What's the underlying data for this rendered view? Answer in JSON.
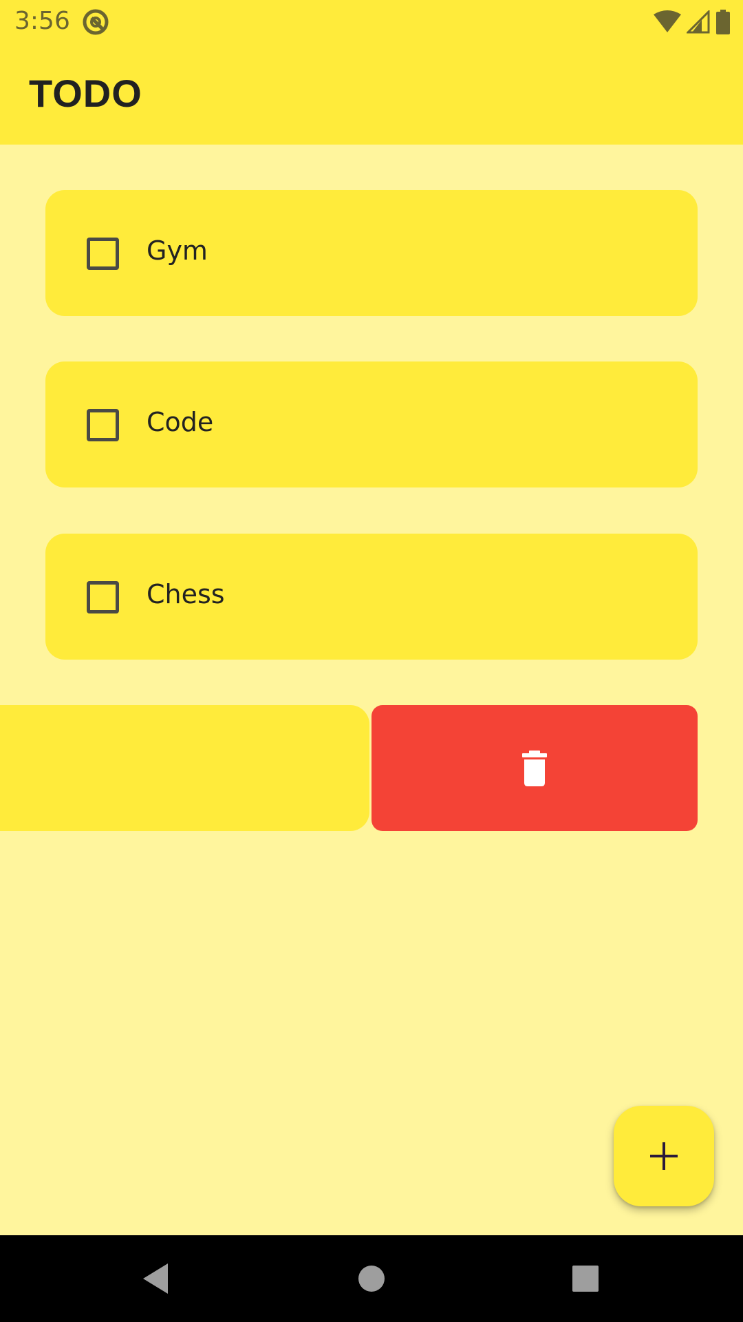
{
  "status_bar": {
    "time": "3:56",
    "icons": [
      "at-sign-notification-icon",
      "wifi-icon",
      "cellular-signal-icon",
      "battery-icon"
    ]
  },
  "app_bar": {
    "title": "TODO"
  },
  "todos": [
    {
      "label": "Gym",
      "checked": false
    },
    {
      "label": "Code",
      "checked": false
    },
    {
      "label": "Chess",
      "checked": false
    }
  ],
  "swipe_item": {
    "action_icon": "trash-icon"
  },
  "fab": {
    "icon": "plus-icon"
  },
  "nav_bar": {
    "buttons": [
      "back-icon",
      "home-icon",
      "recents-icon"
    ]
  },
  "colors": {
    "background": "#FFF59D",
    "primary": "#FFEB3B",
    "delete": "#F44336",
    "nav": "#000000"
  }
}
